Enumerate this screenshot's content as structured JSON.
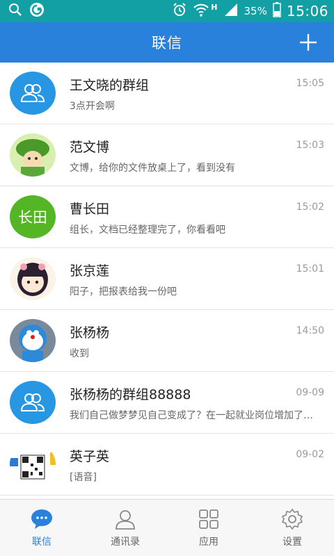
{
  "status_bar": {
    "battery": "35%",
    "time": "15:06",
    "network": "H",
    "icons": [
      "search-icon",
      "app-logo-icon",
      "alarm-icon",
      "wifi-icon",
      "signal-icon",
      "battery-icon"
    ]
  },
  "header": {
    "title": "联信",
    "add_icon": "plus-icon"
  },
  "conversations": [
    {
      "name": "王文晓的群组",
      "message": "3点开会啊",
      "time": "15:05",
      "avatar": "group-icon"
    },
    {
      "name": "范文博",
      "message": "文博，给你的文件放桌上了，看到没有",
      "time": "15:03",
      "avatar": "photo-cartoon-leaf"
    },
    {
      "name": "曹长田",
      "message": "组长，文档已经整理完了，你看看吧",
      "time": "15:02",
      "avatar_text": "长田"
    },
    {
      "name": "张京莲",
      "message": "阳子，把报表给我一份吧",
      "time": "15:01",
      "avatar": "photo-cartoon-girl"
    },
    {
      "name": "张杨杨",
      "message": "收到",
      "time": "14:50",
      "avatar": "photo-doraemon"
    },
    {
      "name": "张杨杨的群组88888",
      "message": "我们自己做梦梦见自己变成了？在一起就业岗位增加了…",
      "time": "09-09",
      "avatar": "group-icon"
    },
    {
      "name": "英子英",
      "message": "[语音]",
      "time": "09-02",
      "avatar": "photo-qr-code"
    }
  ],
  "tabs": [
    {
      "label": "联信",
      "icon": "chat-bubble-icon",
      "active": true
    },
    {
      "label": "通讯录",
      "icon": "contacts-icon",
      "active": false
    },
    {
      "label": "应用",
      "icon": "apps-grid-icon",
      "active": false
    },
    {
      "label": "设置",
      "icon": "settings-icon",
      "active": false
    }
  ],
  "colors": {
    "status_bar": "#12a0a5",
    "header": "#2a81dc",
    "group_avatar": "#2796e3",
    "text_avatar": "#54b625",
    "active_tab": "#2a81dc"
  }
}
